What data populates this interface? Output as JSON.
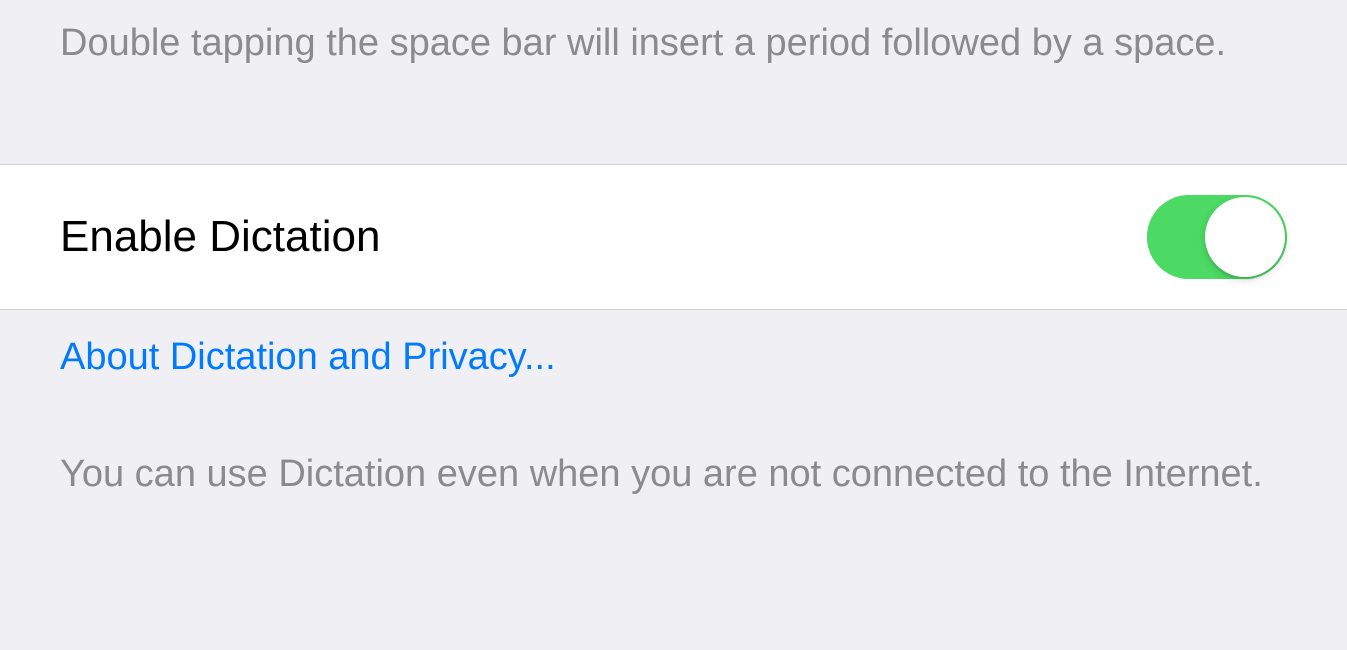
{
  "shortcut_description": "Double tapping the space bar will insert a period followed by a space.",
  "dictation": {
    "label": "Enable Dictation",
    "enabled": true,
    "privacy_link": "About Dictation and Privacy...",
    "offline_note": "You can use Dictation even when you are not connected to the Internet."
  },
  "colors": {
    "background": "#efeff4",
    "row_background": "#ffffff",
    "text_primary": "#000000",
    "text_secondary": "#8a8a8f",
    "link": "#007aff",
    "toggle_on": "#4cd964"
  }
}
